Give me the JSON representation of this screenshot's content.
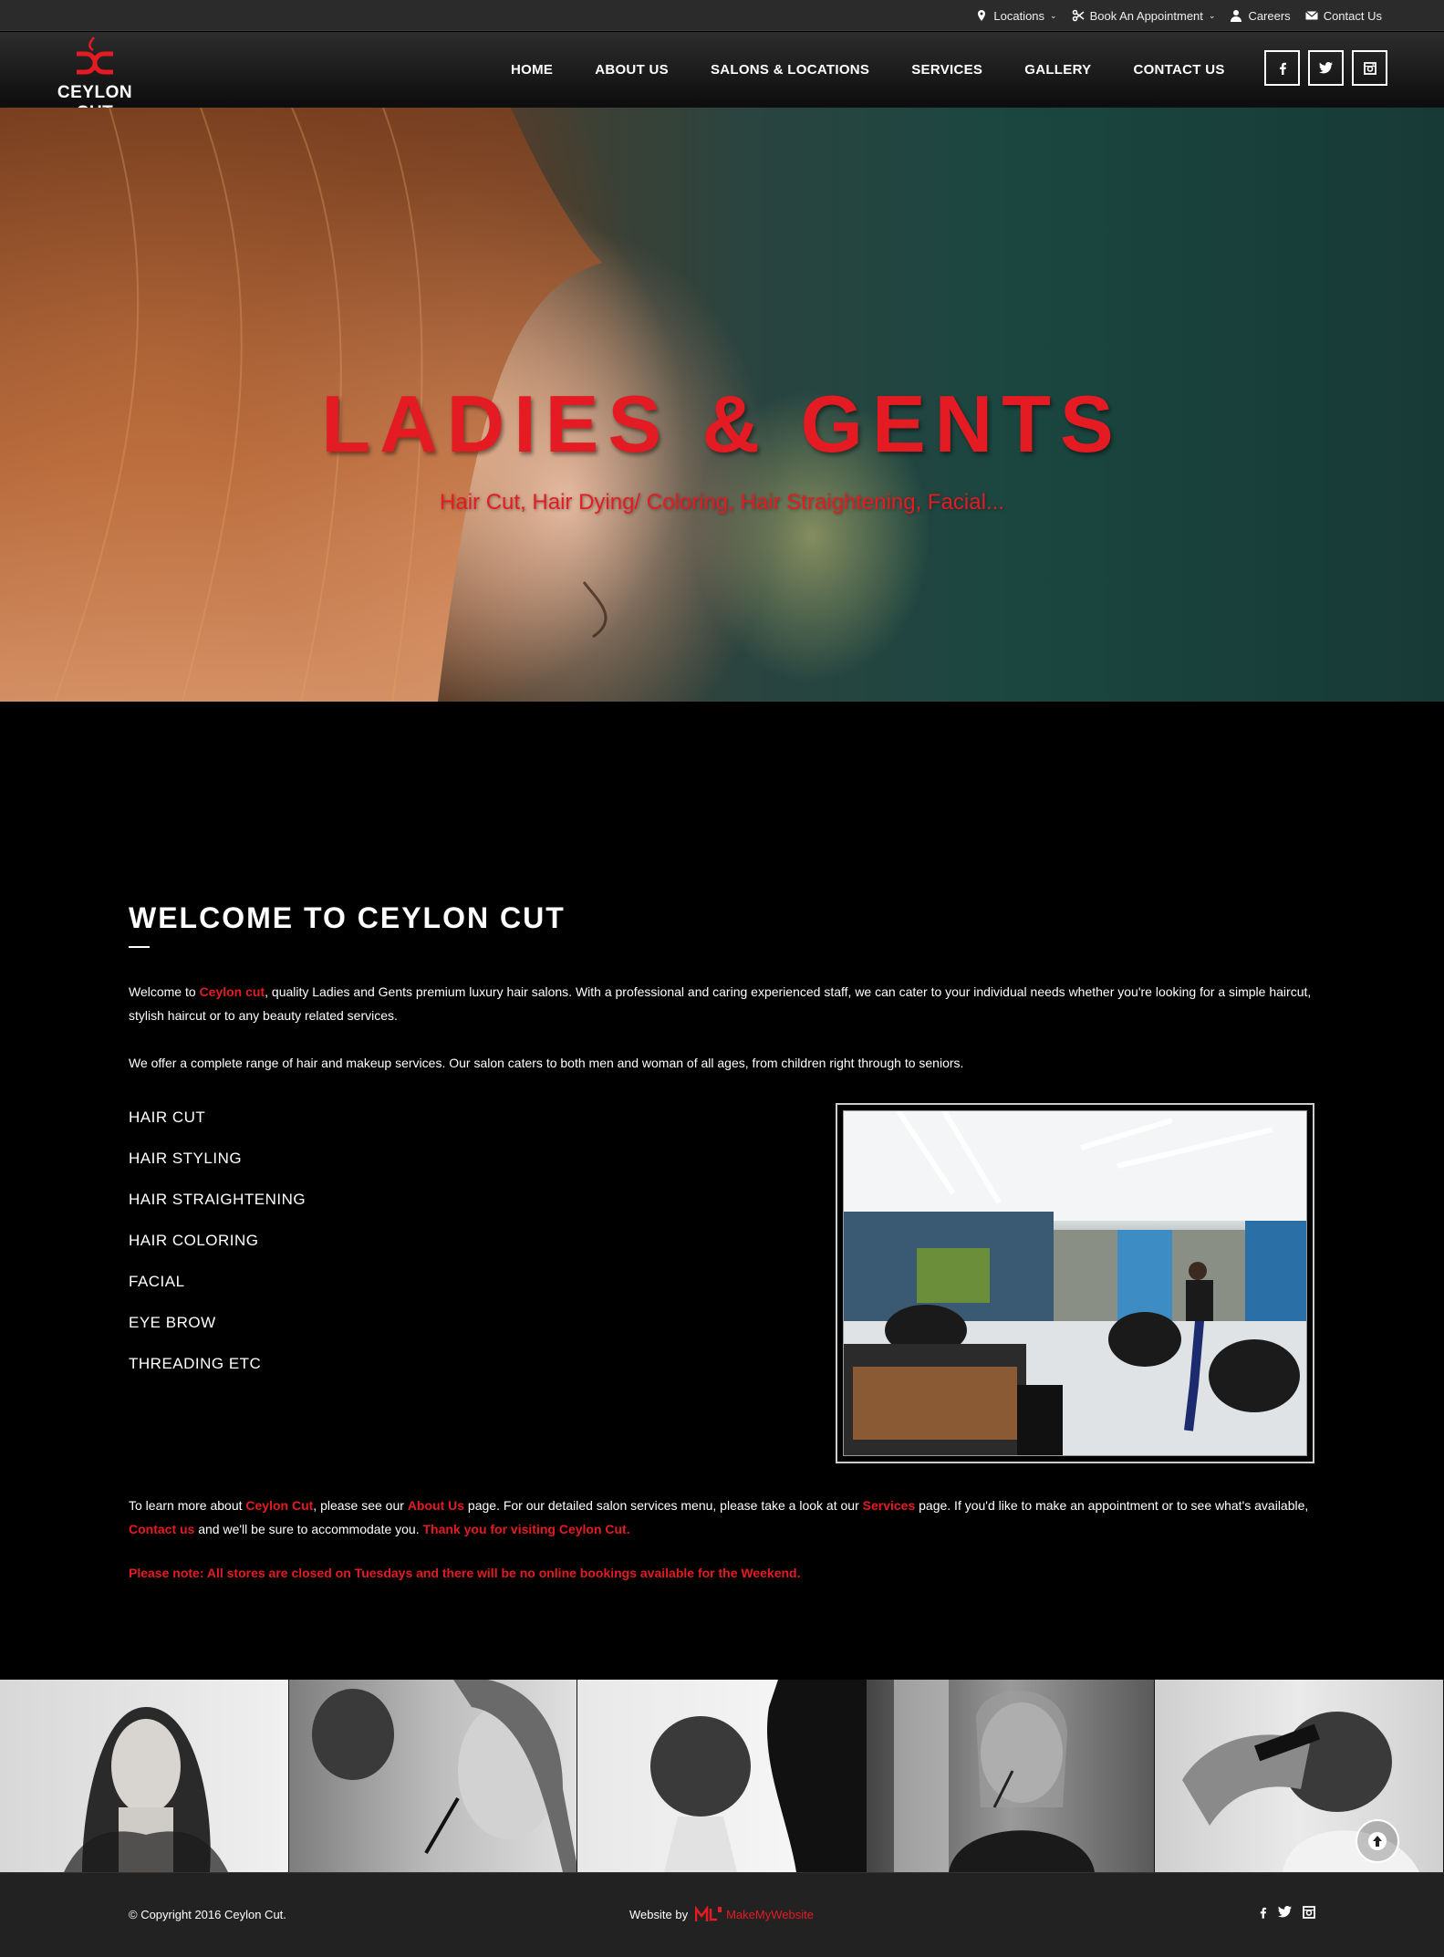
{
  "topbar": {
    "links": [
      {
        "label": "Locations",
        "icon": "map-pin-icon",
        "dropdown": true
      },
      {
        "label": "Book An Appointment",
        "icon": "scissors-icon",
        "dropdown": true
      },
      {
        "label": "Careers",
        "icon": "user-icon",
        "dropdown": false
      },
      {
        "label": "Contact Us",
        "icon": "envelope-icon",
        "dropdown": false
      }
    ]
  },
  "header": {
    "logo_text": "CEYLON CUT",
    "nav": [
      "HOME",
      "ABOUT US",
      "SALONS & LOCATIONS",
      "SERVICES",
      "GALLERY",
      "CONTACT US"
    ],
    "social": [
      "facebook-icon",
      "twitter-icon",
      "instagram-icon"
    ]
  },
  "hero": {
    "title": "LADIES & GENTS",
    "subtitle": "Hair Cut, Hair Dying/ Coloring, Hair Straightening, Facial..."
  },
  "welcome": {
    "title": "WELCOME TO CEYLON CUT",
    "p1": {
      "pre": "Welcome to ",
      "brand": "Ceylon cut",
      "post": ", quality Ladies and Gents premium luxury hair salons. With a professional and caring experienced staff, we can cater to your individual needs whether you're looking for a simple haircut, stylish haircut or to any beauty related services."
    },
    "p2": "We offer a complete range of hair and makeup services. Our salon caters to both men and woman of all ages, from children right through to seniors.",
    "services": [
      "HAIR CUT",
      "HAIR STYLING",
      "HAIR STRAIGHTENING",
      "HAIR COLORING",
      "FACIAL",
      "EYE BROW",
      "THREADING ETC"
    ],
    "p3": {
      "t1": "To learn more about ",
      "brand": "Ceylon Cut",
      "t2": ", please see our ",
      "about": "About Us",
      "t3": " page. For our detailed salon services menu, please take a look at our ",
      "services": "Services",
      "t4": " page. If you'd like to make an appointment or to see what's available, ",
      "contact": "Contact us",
      "t5": " and we'll be sure to accommodate you. ",
      "thanks": "Thank you for visiting Ceylon Cut."
    },
    "note": "Please note: All stores are closed on Tuesdays and there will be no online bookings available for the Weekend."
  },
  "footer": {
    "copyright": "© Copyright 2016 Ceylon Cut.",
    "website_by": "Website by",
    "brand": "MakeMyWebsite",
    "social": [
      "facebook-icon",
      "twitter-icon",
      "instagram-icon"
    ]
  },
  "colors": {
    "accent": "#e41b23",
    "topbar": "#2b2b2b",
    "footer": "#222222"
  }
}
